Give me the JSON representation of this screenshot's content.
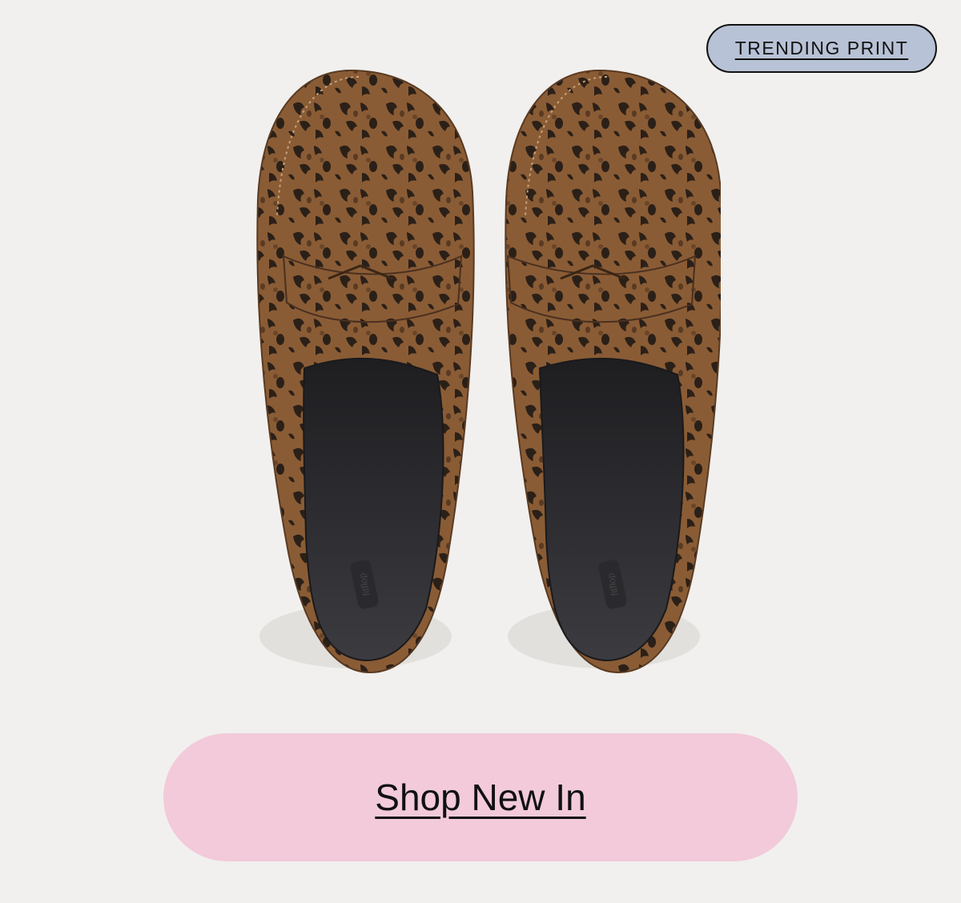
{
  "badge": {
    "label": "TRENDING PRINT"
  },
  "product": {
    "insole_logo": "fitflop",
    "insole_embossing": "ANATOMICALLY"
  },
  "cta": {
    "label": "Shop New In"
  },
  "colors": {
    "background": "#f1f0ee",
    "badge_background": "#b8c2d6",
    "cta_background": "#f2cada",
    "leopard_base": "#8a5c35",
    "leopard_spot": "#2b2018",
    "insole": "#2e2e31"
  }
}
